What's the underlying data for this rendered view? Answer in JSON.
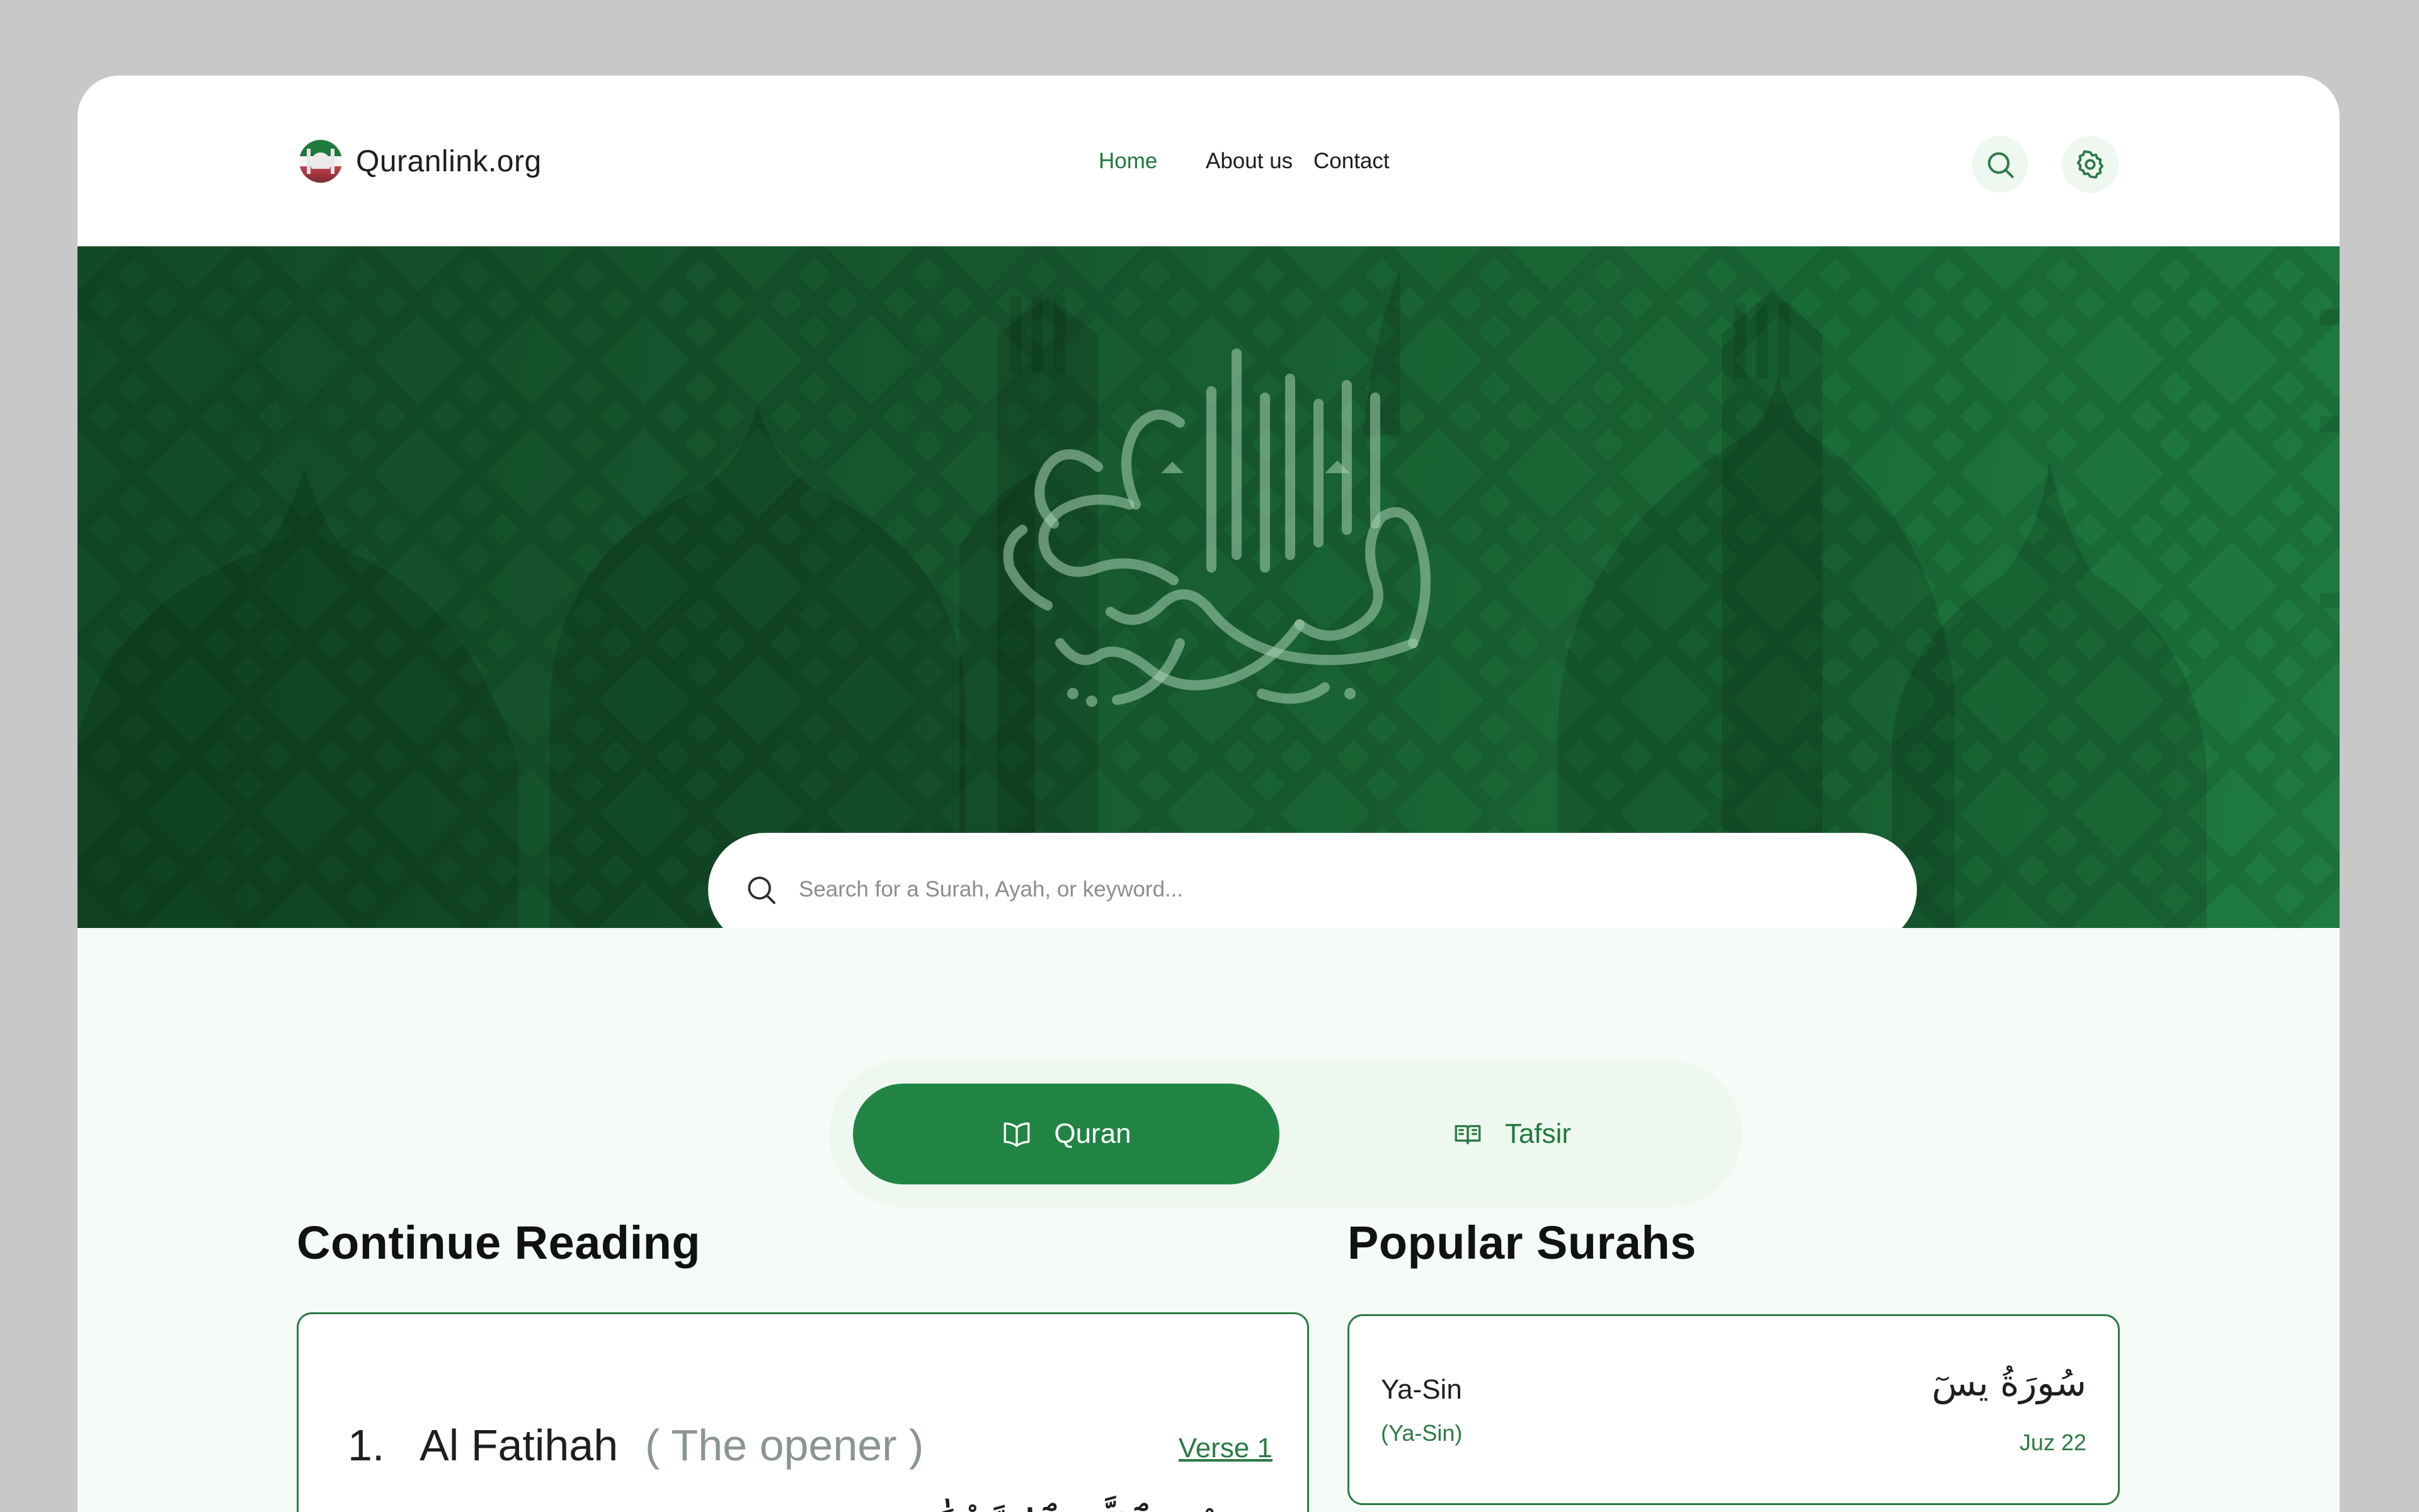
{
  "site": {
    "name": "Quranlink.org"
  },
  "nav": {
    "home": "Home",
    "about": "About us",
    "contact": "Contact"
  },
  "search": {
    "placeholder": "Search for a Surah, Ayah, or keyword..."
  },
  "toggle": {
    "quran": "Quran",
    "tafsir": "Tafsir"
  },
  "continue_reading": {
    "title": "Continue Reading",
    "number": "1.",
    "name": "Al Fatihah",
    "translation": "( The opener )",
    "verse": "Verse 1",
    "arabic": "بِسْمِ ٱللَّهِ ٱلرَّحْمَٰنِ"
  },
  "popular": {
    "title": "Popular Surahs",
    "items": [
      {
        "name": "Ya-Sin",
        "translation": "(Ya-Sin)",
        "arabic": "سُورَةُ يسٓ",
        "juz": "Juz 22"
      }
    ]
  },
  "colors": {
    "accent": "#228444",
    "hero_dark": "#124a26",
    "hero_light": "#1f7c40",
    "text": "#1b1f1d"
  }
}
